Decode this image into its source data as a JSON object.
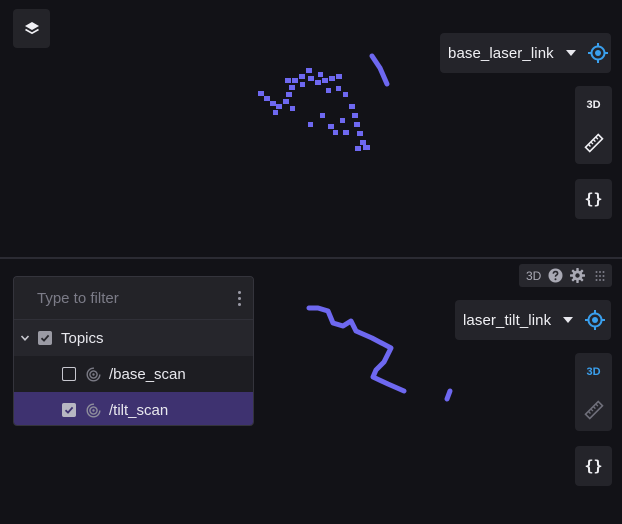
{
  "top_panel": {
    "frame_select": {
      "label": "base_laser_link"
    },
    "tools": {
      "mode_3d": "3D",
      "braces": "{}"
    }
  },
  "bottom_panel": {
    "toolbar": {
      "label_3d": "3D"
    },
    "frame_select": {
      "label": "laser_tilt_link"
    },
    "tools": {
      "mode_3d": "3D",
      "braces": "{}"
    },
    "topics_panel": {
      "filter_placeholder": "Type to filter",
      "filter_value": "",
      "root": {
        "label": "Topics",
        "checked": true,
        "expanded": true
      },
      "items": [
        {
          "label": "/base_scan",
          "checked": false,
          "selected": false
        },
        {
          "label": "/tilt_scan",
          "checked": true,
          "selected": true
        }
      ]
    }
  },
  "colors": {
    "background": "#121217",
    "control_bg": "#24242a",
    "point_cloud": "#6e68f0",
    "accent_blue": "#3aa0ee",
    "selected_row": "#3e3270"
  }
}
